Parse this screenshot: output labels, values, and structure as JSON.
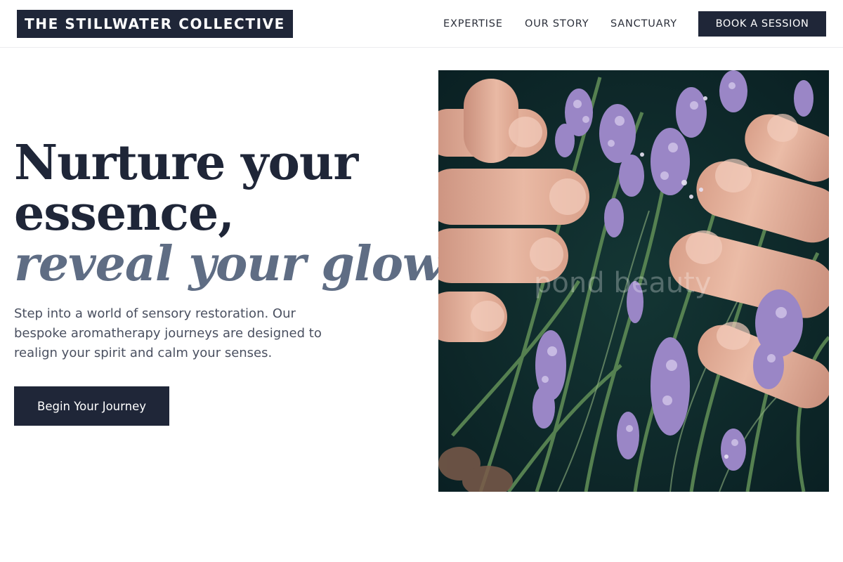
{
  "header": {
    "brand": "THE STILLWATER COLLECTIVE",
    "nav": [
      "EXPERTISE",
      "OUR STORY",
      "SANCTUARY"
    ],
    "cta_label": "BOOK A SESSION"
  },
  "hero": {
    "headline_line1": "Nurture your",
    "headline_line2": "essence,",
    "headline_accent": "reveal your glow.",
    "body": "Step into a world of sensory restoration. Our bespoke aromatherapy journeys are designed to realign your spirit and calm your senses.",
    "cta_label": "Begin Your Journey",
    "image_watermark": "pond beauty"
  },
  "colors": {
    "navy": "#1f2638",
    "accent_slate": "#5f6d84",
    "body_text": "#4a5060",
    "lavender": "#9a86c6",
    "leaf_green": "#4f7a4a",
    "image_background": "#0e2a2b"
  }
}
